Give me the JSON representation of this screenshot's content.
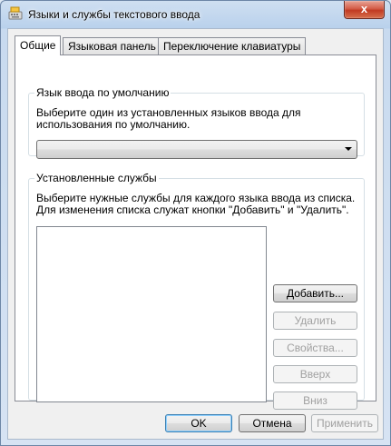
{
  "window": {
    "title": "Языки и службы текстового ввода",
    "close_glyph": "x"
  },
  "tabs": [
    {
      "label": "Общие",
      "active": true
    },
    {
      "label": "Языковая панель",
      "active": false
    },
    {
      "label": "Переключение клавиатуры",
      "active": false
    }
  ],
  "default_language": {
    "legend": "Язык ввода по умолчанию",
    "description": "Выберите один из установленных языков ввода для использования по умолчанию.",
    "selected_value": ""
  },
  "installed_services": {
    "legend": "Установленные службы",
    "description": "Выберите нужные службы для каждого языка ввода из списка. Для изменения списка служат кнопки \"Добавить\" и \"Удалить\".",
    "buttons": {
      "add": "Добавить...",
      "remove": "Удалить",
      "properties": "Свойства...",
      "up": "Вверх",
      "down": "Вниз"
    }
  },
  "footer": {
    "ok": "OK",
    "cancel": "Отмена",
    "apply": "Применить"
  },
  "colors": {
    "accent_border": "#3c7fb1",
    "close_button": "#c13a22",
    "disabled_text": "#a0a0a0"
  },
  "icons": {
    "title_icon": "keyboard-icon",
    "combo_arrow": "chevron-down-icon"
  }
}
